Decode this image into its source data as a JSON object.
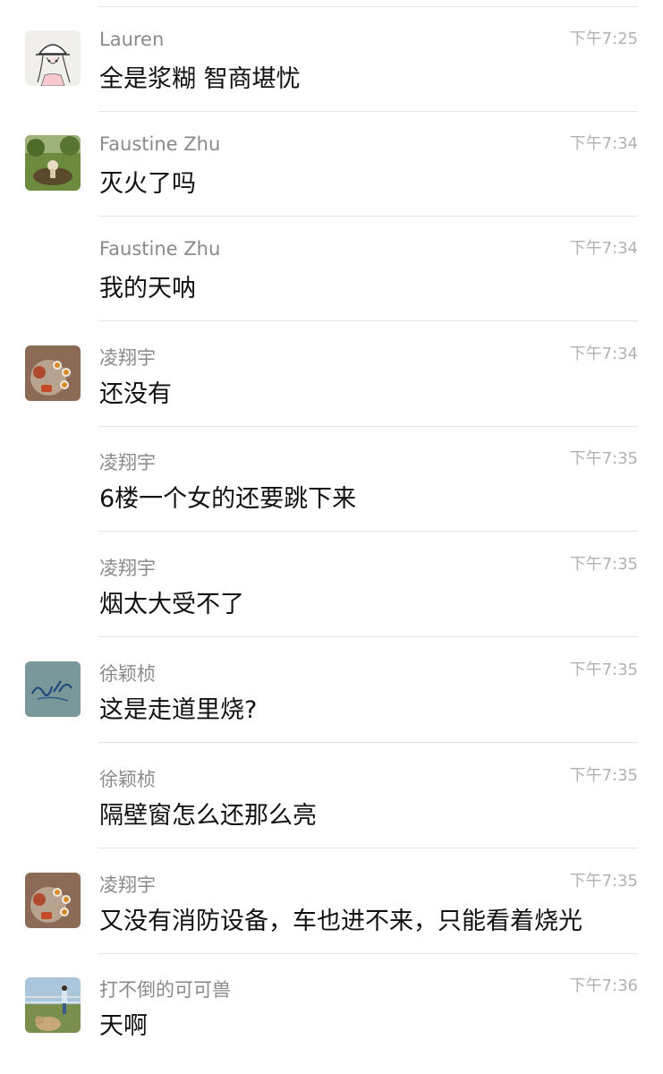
{
  "messages": [
    {
      "sender": "Lauren",
      "time": "下午7:25",
      "text": "全是浆糊 智商堪忧",
      "avatar": "lauren-avatar"
    },
    {
      "sender": "Faustine Zhu",
      "time": "下午7:34",
      "text": "灭火了吗",
      "avatar": "faustine-avatar"
    },
    {
      "sender": "Faustine Zhu",
      "time": "下午7:34",
      "text": "我的天呐",
      "avatar": null
    },
    {
      "sender": "凌翔宇",
      "time": "下午7:34",
      "text": "还没有",
      "avatar": "teaset-avatar"
    },
    {
      "sender": "凌翔宇",
      "time": "下午7:35",
      "text": "6楼一个女的还要跳下来",
      "avatar": null
    },
    {
      "sender": "凌翔宇",
      "time": "下午7:35",
      "text": "烟太大受不了",
      "avatar": null
    },
    {
      "sender": "徐颖桢",
      "time": "下午7:35",
      "text": "这是走道里烧?",
      "avatar": "sketch-avatar"
    },
    {
      "sender": "徐颖桢",
      "time": "下午7:35",
      "text": "隔壁窗怎么还那么亮",
      "avatar": null
    },
    {
      "sender": "凌翔宇",
      "time": "下午7:35",
      "text": "又没有消防设备，车也进不来，只能看着烧光",
      "avatar": "teaset-avatar"
    },
    {
      "sender": "打不倒的可可兽",
      "time": "下午7:36",
      "text": "天啊",
      "avatar": "outdoor-avatar"
    }
  ]
}
